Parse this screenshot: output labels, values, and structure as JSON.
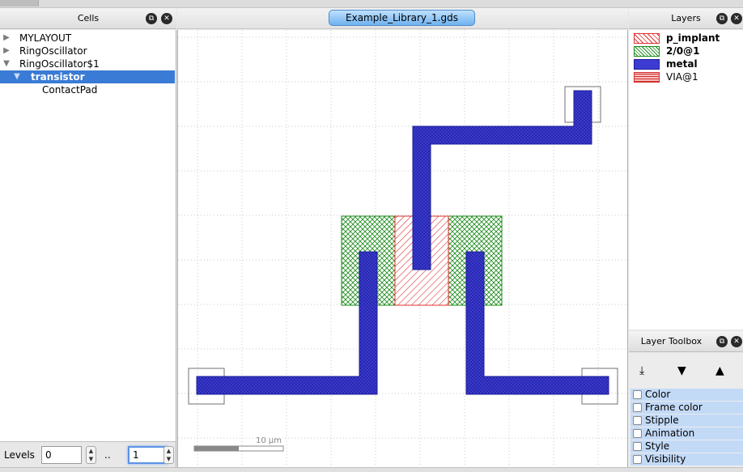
{
  "cells_panel": {
    "title": "Cells",
    "tree": [
      {
        "label": "MYLAYOUT",
        "expanded": false,
        "depth": 0
      },
      {
        "label": "RingOscillator",
        "expanded": false,
        "depth": 0
      },
      {
        "label": "RingOscillator$1",
        "expanded": true,
        "depth": 0
      },
      {
        "label": "transistor",
        "expanded": true,
        "depth": 1,
        "selected": true
      },
      {
        "label": "ContactPad",
        "expanded": false,
        "depth": 2,
        "leaf": true
      }
    ],
    "levels_label": "Levels",
    "level_from": "0",
    "range_sep": "..",
    "level_to": "1"
  },
  "canvas": {
    "file_tab": "Example_Library_1.gds",
    "scale_label": "10 µm"
  },
  "layers_panel": {
    "title": "Layers",
    "layers": [
      {
        "name": "p_implant",
        "bold": true,
        "color": "#e03030",
        "pattern": "hatch"
      },
      {
        "name": "2/0@1",
        "bold": false,
        "color": "#1a8a1a",
        "pattern": "cross"
      },
      {
        "name": "metal",
        "bold": true,
        "color": "#3333cc",
        "pattern": "solid"
      },
      {
        "name": "VIA@1",
        "bold": false,
        "color": "#d03030",
        "pattern": "grid"
      }
    ]
  },
  "layer_toolbox": {
    "title": "Layer Toolbox",
    "properties": [
      "Color",
      "Frame color",
      "Stipple",
      "Animation",
      "Style",
      "Visibility"
    ]
  },
  "icons": {
    "float": "float-icon",
    "close": "close-icon",
    "move_bottom": "move-to-bottom-icon",
    "move_down": "move-down-icon",
    "move_up": "move-up-icon"
  }
}
